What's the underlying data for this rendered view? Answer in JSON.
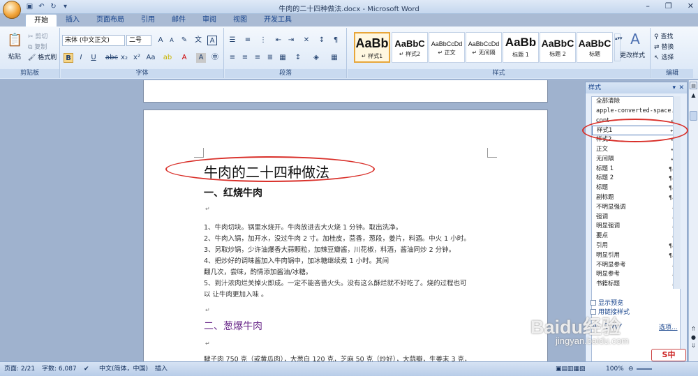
{
  "window": {
    "title": "牛肉的二十四种做法.docx - Microsoft Word"
  },
  "ribbon_tabs": [
    "开始",
    "插入",
    "页面布局",
    "引用",
    "邮件",
    "审阅",
    "视图",
    "开发工具"
  ],
  "clipboard": {
    "paste": "粘贴",
    "cut": "剪切",
    "copy": "复制",
    "format_painter": "格式刷",
    "label": "剪贴板"
  },
  "font": {
    "name": "宋体 (中文正文)",
    "size": "二号",
    "label": "字体"
  },
  "paragraph": {
    "label": "段落"
  },
  "styles_gallery": {
    "items": [
      {
        "preview": "AaBb",
        "name": "↵ 样式1"
      },
      {
        "preview": "AaBbC",
        "name": "↵ 样式2"
      },
      {
        "preview": "AaBbCcDd",
        "name": "↵ 正文"
      },
      {
        "preview": "AaBbCcDd",
        "name": "↵ 无间隔"
      },
      {
        "preview": "AaBb",
        "name": "标题 1"
      },
      {
        "preview": "AaBbC",
        "name": "标题 2"
      },
      {
        "preview": "AaBbC",
        "name": "标题"
      }
    ],
    "change_styles": "更改样式",
    "label": "样式"
  },
  "editing": {
    "find": "查找",
    "replace": "替换",
    "select": "选择",
    "label": "编辑"
  },
  "document": {
    "title": "牛肉的二十四种做法",
    "heading1": "一、红烧牛肉",
    "lines": [
      "1、牛肉切块。锅里水烧开。牛肉放进去大火烧 1 分钟。取出洗净。",
      "2、牛肉入锅，加开水，没过牛肉 2 寸。加桂皮，茴香，葱段，姜片，料酒。中火 1 小时。",
      "3、另取炒锅，少许油爆香大蒜颗粒，加辣豆瓣酱，川花椒，料酒，酱油同炒 2 分钟。",
      "4、把炒好的调味酱加入牛肉锅中，加冰糖继续煮 1 小时。其间",
      "翻几次，尝味，酌情添加酱油/冰糖。",
      "5、到汁浓肉烂关掉火即成。一定不能吝啬火头。没有这么酥烂就不好吃了。烧的过程也可",
      "以 让牛肉更加入味 。"
    ],
    "heading2": "二、葱爆牛肉",
    "last_line": "腱子肉 750 克（或黄瓜肉），大葱白 120 克，芝麻 50 克（炒好），大蒜瓣，生姜末 3 克，"
  },
  "styles_pane": {
    "title": "样式",
    "items": [
      {
        "name": "全部清除",
        "kind": ""
      },
      {
        "name": "apple-converted-space",
        "kind": "a"
      },
      {
        "name": "cont",
        "kind": "↵"
      },
      {
        "name": "样式1",
        "kind": "↵"
      },
      {
        "name": "样式2",
        "kind": "↵"
      },
      {
        "name": "正文",
        "kind": "↵"
      },
      {
        "name": "无间隔",
        "kind": "↵"
      },
      {
        "name": "标题 1",
        "kind": "¶a"
      },
      {
        "name": "标题 2",
        "kind": "¶a"
      },
      {
        "name": "标题",
        "kind": "¶a"
      },
      {
        "name": "副标题",
        "kind": "¶a"
      },
      {
        "name": "不明显强调",
        "kind": "a"
      },
      {
        "name": "强调",
        "kind": "a"
      },
      {
        "name": "明显强调",
        "kind": "a"
      },
      {
        "name": "要点",
        "kind": "a"
      },
      {
        "name": "引用",
        "kind": "¶a"
      },
      {
        "name": "明显引用",
        "kind": "¶a"
      },
      {
        "name": "不明显参考",
        "kind": "a"
      },
      {
        "name": "明显参考",
        "kind": "a"
      },
      {
        "name": "书籍标题",
        "kind": "a"
      }
    ],
    "show_preview": "显示预览",
    "disable_linked": "用链接样式",
    "options": "选项..."
  },
  "status": {
    "page": "页面: 2/21",
    "words": "字数: 6,087",
    "language": "中文(简体，中国)",
    "mode": "插入",
    "zoom": "100%"
  },
  "watermark": {
    "brand": "Baidu经验",
    "url": "jingyan.baidu.com"
  },
  "ime": {
    "label": "中"
  },
  "colors": {
    "annotation": "#d9302a",
    "ribbon_bg": "#dbe7f6",
    "highlight": "#e7a63a",
    "heading2": "#6a2a8a"
  }
}
